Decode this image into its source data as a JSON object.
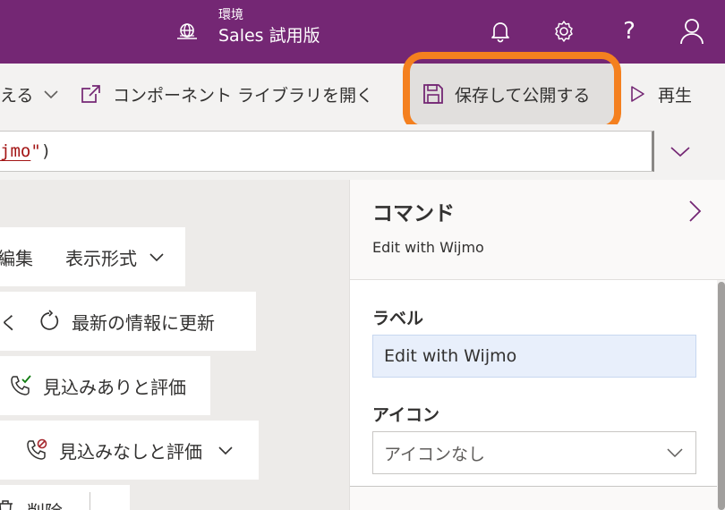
{
  "header": {
    "env_label": "環境",
    "env_name": "Sales 試用版",
    "icons": [
      "globe-icon",
      "bell-icon",
      "gear-icon",
      "help-icon",
      "person-icon"
    ]
  },
  "commandbar": {
    "partial_label": "える",
    "library_label": "コンポーネント ライブラリを開く",
    "save_label": "保存して公開する",
    "play_label": "再生"
  },
  "formula": {
    "prefix": "",
    "string_part": "jmo",
    "suffix_quote": "\"",
    "close_paren": ")"
  },
  "canvas": {
    "edit_label": "編集",
    "display_format_label": "表示形式",
    "open_partial": "開く",
    "refresh_label": "最新の情報に更新",
    "qualify_label": "見込みありと評価",
    "disqualify_label": "見込みなしと評価",
    "delete_partial": "削除"
  },
  "panel": {
    "title": "コマンド",
    "subtitle": "Edit with Wijmo",
    "label_field_title": "ラベル",
    "label_field_value": "Edit with Wijmo",
    "icon_field_title": "アイコン",
    "icon_field_value": "アイコンなし"
  },
  "colors": {
    "header_bg": "#742774",
    "highlight": "#f4801f",
    "accent": "#742774"
  }
}
